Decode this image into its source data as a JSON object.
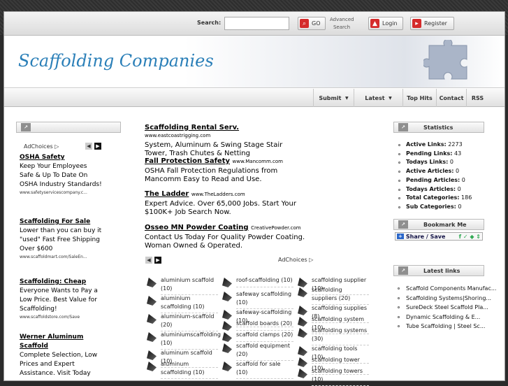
{
  "search": {
    "label": "Search:",
    "value": "",
    "go": "GO",
    "advanced": "Advanced Search",
    "login": "Login",
    "register": "Register"
  },
  "site": {
    "title": "Scaffolding Companies"
  },
  "nav": [
    {
      "label": "Submit",
      "arrow": "▼"
    },
    {
      "label": "Latest",
      "arrow": "▼"
    },
    {
      "label": "Top Hits",
      "arrow": ""
    },
    {
      "label": "Contact",
      "arrow": ""
    },
    {
      "label": "RSS",
      "arrow": ""
    }
  ],
  "left": {
    "adchoices": "AdChoices ▷",
    "ads": [
      {
        "title": "OSHA Safety",
        "desc": "Keep Your Employees Safe & Up To Date On OSHA Industry Standards!",
        "url": "www.safetyservicescompany.c..."
      },
      {
        "title": "Scaffolding For Sale",
        "desc": "Lower than you can buy it \"used\" Fast Free Shipping Over $600",
        "url": "www.scaffoldmart.com/SaleEn..."
      },
      {
        "title": "Scaffolding: Cheap",
        "desc": "Everyone Wants to Pay a Low Price. Best Value for Scaffolding!",
        "url": "www.scaffoldstore.com/Save"
      },
      {
        "title": "Werner Aluminum Scaffold",
        "desc": "Complete Selection, Low Prices and Expert Assistance. Visit Today",
        "url": ""
      }
    ]
  },
  "center": {
    "adchoices": "AdChoices ▷",
    "ads": [
      {
        "title": "Scaffolding Rental Serv.",
        "url": "www.eastcoastrigging.com",
        "desc": "System, Aluminum & Swing Stage Stair Tower, Trash Chutes & Netting"
      },
      {
        "title": "Fall Protection Safety",
        "url": "www.Mancomm.com",
        "desc": "OSHA Fall Protection Regulations from Mancomm Easy to Read and Use."
      },
      {
        "title": "The Ladder",
        "url": "www.TheLadders.com",
        "desc": "Expert Advice. Over 65,000 Jobs. Start Your $100K+ Job Search Now."
      },
      {
        "title": "Osseo MN Powder Coating",
        "url": "CreativePowder.com",
        "desc": "Contact Us Today For Quality Powder Coating. Woman Owned & Operated."
      }
    ],
    "tags": [
      [
        "aluminium scaffold (10)",
        "aluminium scaffolding (10)",
        "aluminium-scaffold (20)",
        "aluminiumscaffolding (10)",
        "aluminum scaffold (10)",
        "aluminum scaffolding (10)"
      ],
      [
        "roof-scaffolding (10)",
        "safeway scaffolding (10)",
        "safeway-scaffolding (10)",
        "scaffold boards (20)",
        "scaffold clamps (20)",
        "scaffold equipment (20)",
        "scaffold for sale (10)"
      ],
      [
        "scaffolding supplier (10)",
        "scaffolding suppliers (20)",
        "scaffolding supplies (8)",
        "scaffolding system (10)",
        "scaffolding systems (30)",
        "scaffolding tools (10)",
        "scaffolding tower (10)",
        "scaffolding towers (10)"
      ]
    ]
  },
  "right": {
    "stats_title": "Statistics",
    "stats": [
      {
        "label": "Active Links:",
        "value": "2273"
      },
      {
        "label": "Pending Links:",
        "value": "43"
      },
      {
        "label": "Todays Links:",
        "value": "0"
      },
      {
        "label": "Active Articles:",
        "value": "0"
      },
      {
        "label": "Pending Articles:",
        "value": "0"
      },
      {
        "label": "Todays Articles:",
        "value": "0"
      },
      {
        "label": "Total Categories:",
        "value": "186"
      },
      {
        "label": "Sub Categories:",
        "value": "0"
      }
    ],
    "bookmark_title": "Bookmark Me",
    "share_label": "Share / Save",
    "latest_title": "Latest links",
    "latest": [
      "Scaffold Components Manufac...",
      "Scaffolding Systems|Shoring...",
      "SureDeck Steel Scaffold Pla...",
      "Dynamic Scaffolding & E...",
      "Tube Scaffolding | Steel Sc..."
    ]
  }
}
